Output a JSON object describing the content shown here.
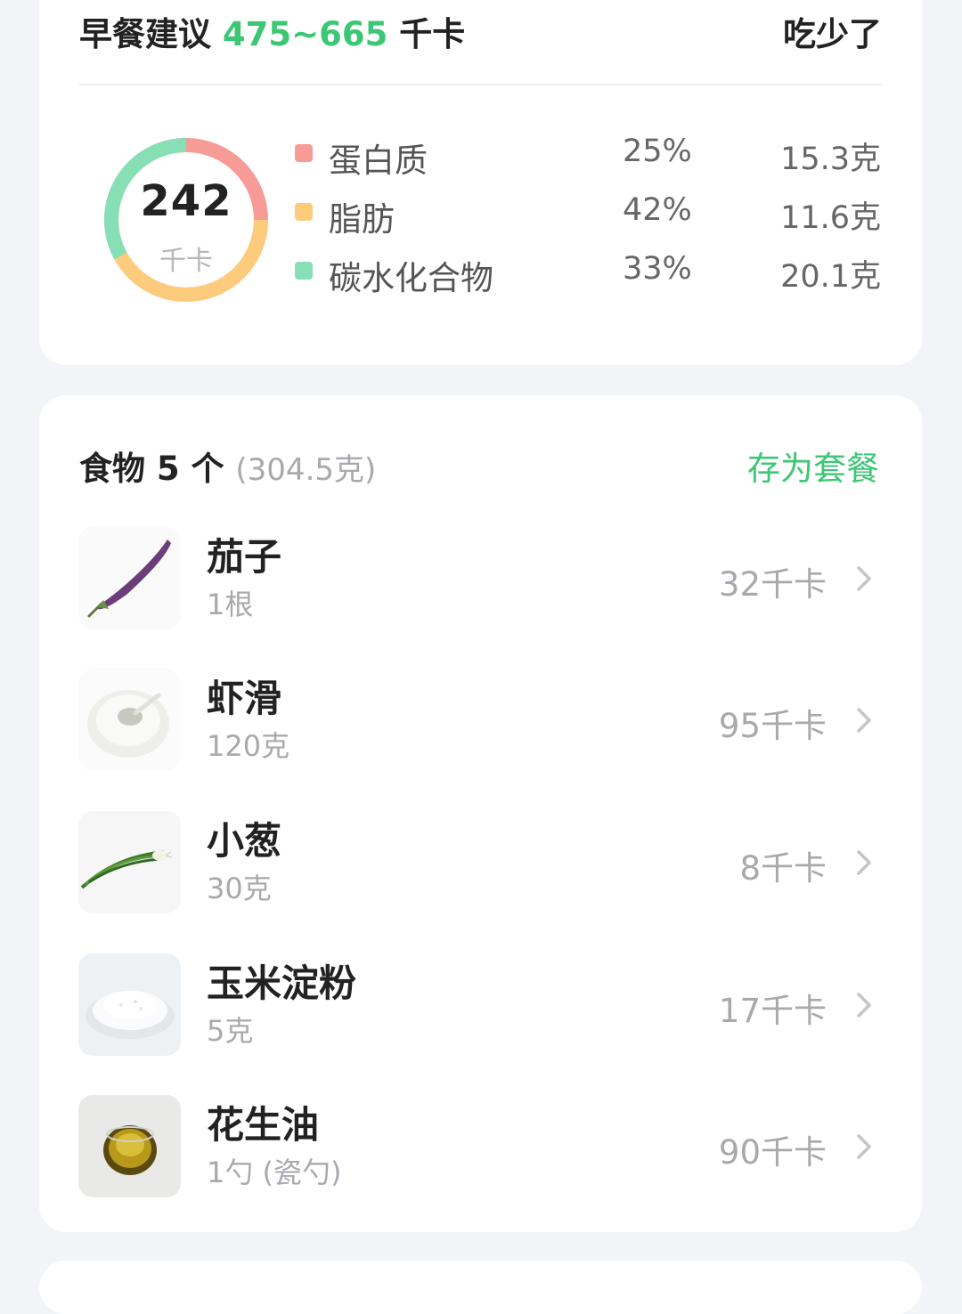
{
  "summary": {
    "title_prefix": "早餐建议",
    "title_range": "475~665",
    "title_unit": "千卡",
    "status_action": "吃少了",
    "kcal": "242",
    "kcal_unit": "千卡",
    "macros": [
      {
        "name": "蛋白质",
        "percent": "25%",
        "grams": "15.3克",
        "color": "#f79b96"
      },
      {
        "name": "脂肪",
        "percent": "42%",
        "grams": "11.6克",
        "color": "#fdcb7c"
      },
      {
        "name": "碳水化合物",
        "percent": "33%",
        "grams": "20.1克",
        "color": "#86dfb5"
      }
    ]
  },
  "foods": {
    "title": "食物 5 个",
    "total_weight": "(304.5克)",
    "save_action": "存为套餐",
    "items": [
      {
        "name": "茄子",
        "quantity": "1根",
        "kcal": "32千卡",
        "icon": "eggplant-photo"
      },
      {
        "name": "虾滑",
        "quantity": "120克",
        "kcal": "95千卡",
        "icon": "shrimp-paste-photo"
      },
      {
        "name": "小葱",
        "quantity": "30克",
        "kcal": "8千卡",
        "icon": "scallion-photo"
      },
      {
        "name": "玉米淀粉",
        "quantity": "5克",
        "kcal": "17千卡",
        "icon": "cornstarch-photo"
      },
      {
        "name": "花生油",
        "quantity": "1勺 (瓷勺)",
        "kcal": "90千卡",
        "icon": "peanut-oil-photo"
      }
    ]
  },
  "colors": {
    "accent": "#3cc774",
    "protein": "#f79b96",
    "fat": "#fdcb7c",
    "carbs": "#86dfb5"
  }
}
